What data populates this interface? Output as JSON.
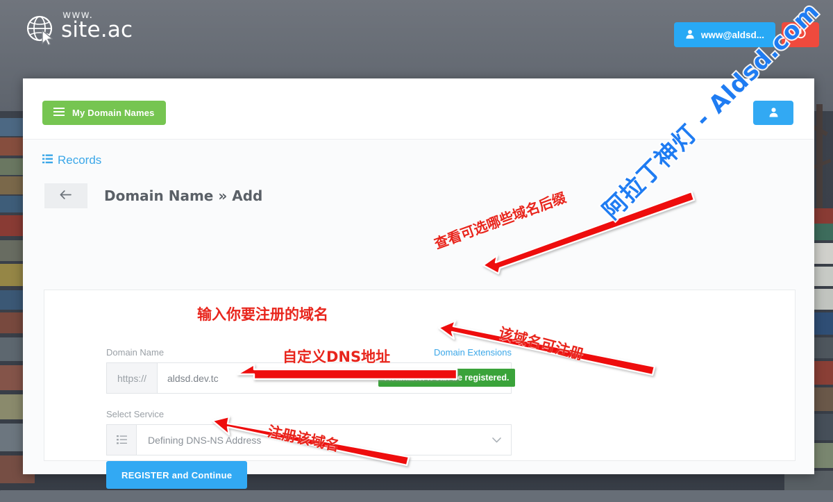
{
  "header": {
    "logo": {
      "www": "www.",
      "name": "site.ac",
      "icon": "globe-cursor-icon"
    },
    "user_button": {
      "label": "www@aldsd...",
      "icon": "user-icon",
      "color": "#28a9f5"
    },
    "power_button": {
      "label": "",
      "icon": "power-icon",
      "color": "#ef4a3d"
    }
  },
  "panel": {
    "domains_button": {
      "label": "My Domain Names",
      "icon": "hamburger-icon",
      "color": "#76c551"
    },
    "account_button": {
      "icon": "user-icon",
      "color": "#32a9f3"
    },
    "records_link": {
      "label": "Records",
      "icon": "list-icon",
      "color": "#3ba7e8"
    },
    "back_button": {
      "icon": "arrow-left-icon"
    },
    "title": "Domain Name » Add"
  },
  "form": {
    "domain_name": {
      "label": "Domain Name",
      "extensions_link": "Domain Extensions",
      "prefix": "https://",
      "value": "aldsd.dev.tc",
      "placeholder": "aldsd.dev.tc",
      "availability": {
        "text": "Available. It can be registered.",
        "color": "#3aa33a"
      }
    },
    "select_service": {
      "label": "Select Service",
      "value": "Defining DNS-NS Address",
      "icon": "list-icon",
      "caret": "chevron-down-icon"
    },
    "submit_button": {
      "label": "REGISTER and Continue",
      "color": "#32a9f3"
    }
  },
  "annotations": [
    {
      "text": "查看可选哪些域名后缀",
      "target": "domain-extensions-link"
    },
    {
      "text": "输入你要注册的域名",
      "target": "domain-name-input"
    },
    {
      "text": "该域名可注册",
      "target": "availability-badge"
    },
    {
      "text": "自定义DNS地址",
      "target": "select-service-dropdown"
    },
    {
      "text": "注册该域名",
      "target": "register-button"
    }
  ],
  "watermark": {
    "text": "阿拉丁神灯 - Aldsd.com",
    "color": "#1f7cf2"
  }
}
